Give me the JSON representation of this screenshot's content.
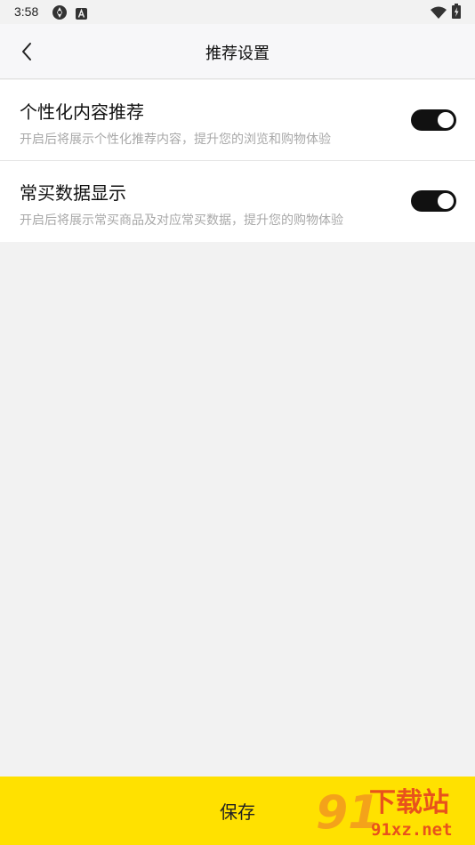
{
  "status_bar": {
    "time": "3:58"
  },
  "header": {
    "title": "推荐设置"
  },
  "settings": [
    {
      "title": "个性化内容推荐",
      "description": "开启后将展示个性化推荐内容，提升您的浏览和购物体验",
      "enabled": true
    },
    {
      "title": "常买数据显示",
      "description": "开启后将展示常买商品及对应常买数据，提升您的购物体验",
      "enabled": true
    }
  ],
  "footer": {
    "save_label": "保存"
  },
  "watermark": {
    "number": "91",
    "text": "下载站",
    "url": "91xz.net"
  },
  "colors": {
    "accent_yellow": "#ffe100",
    "toggle_on": "#111111",
    "background": "#f2f2f2"
  }
}
